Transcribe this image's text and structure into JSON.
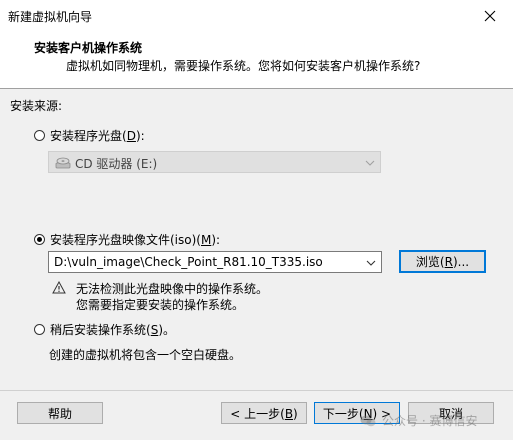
{
  "window": {
    "title": "新建虚拟机向导"
  },
  "header": {
    "title": "安装客户机操作系统",
    "subtitle": "虚拟机如同物理机，需要操作系统。您将如何安装客户机操作系统?"
  },
  "source": {
    "label": "安装来源:",
    "disc_option": {
      "label": "安装程序光盘(",
      "key": "D",
      "suffix": "):",
      "selected": false
    },
    "disc_drive": {
      "value": "CD 驱动器 (E:)"
    },
    "iso_option": {
      "label": "安装程序光盘映像文件(iso)(",
      "key": "M",
      "suffix": "):",
      "selected": true
    },
    "iso_path": {
      "value": "D:\\vuln_image\\Check_Point_R81.10_T335.iso"
    },
    "browse_button": {
      "label": "浏览(",
      "key": "R",
      "suffix": ")..."
    },
    "warning": {
      "line1": "无法检测此光盘映像中的操作系统。",
      "line2": "您需要指定要安装的操作系统。"
    },
    "later_option": {
      "label": "稍后安装操作系统(",
      "key": "S",
      "suffix": ")。",
      "selected": false
    },
    "later_desc": "创建的虚拟机将包含一个空白硬盘。"
  },
  "footer": {
    "help": "帮助",
    "back": {
      "label": "< 上一步(",
      "key": "B",
      "suffix": ")"
    },
    "next": {
      "label": "下一步(",
      "key": "N",
      "suffix": ") >"
    },
    "cancel": "取消"
  },
  "watermark": {
    "text": "公众号 · 赛博信安"
  },
  "colors": {
    "focus": "#0078d7",
    "button_bg": "#e1e1e1",
    "dialog_bg": "#f0f0f0"
  }
}
